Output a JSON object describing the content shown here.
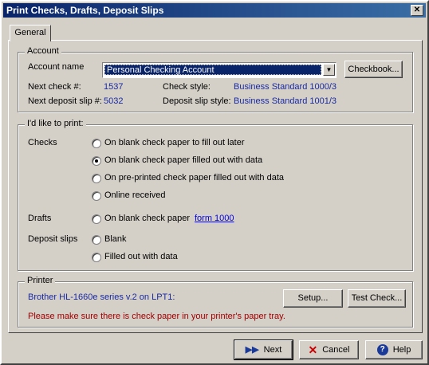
{
  "window": {
    "title": "Print Checks, Drafts, Deposit Slips",
    "close_glyph": "✕"
  },
  "tabs": [
    {
      "label": "General"
    }
  ],
  "account": {
    "group_label": "Account",
    "name_label": "Account name",
    "selected_account": "Personal Checking Account",
    "checkbook_button": "Checkbook...",
    "next_check_label": "Next check #:",
    "next_check_value": "1537",
    "check_style_label": "Check style:",
    "check_style_value": "Business Standard 1000/3",
    "next_deposit_label": "Next deposit slip #:",
    "next_deposit_value": "5032",
    "deposit_style_label": "Deposit slip style:",
    "deposit_style_value": "Business Standard 1001/3"
  },
  "print": {
    "group_label": "I'd like to print:",
    "checks_label": "Checks",
    "checks_options": [
      {
        "label": "On blank check paper to fill out later",
        "selected": false
      },
      {
        "label": "On blank check paper filled out with data",
        "selected": true
      },
      {
        "label": "On pre-printed check paper filled out with data",
        "selected": false
      },
      {
        "label": "Online received",
        "selected": false
      }
    ],
    "drafts_label": "Drafts",
    "drafts_option": {
      "label": "On blank check paper",
      "selected": false
    },
    "drafts_link": "form 1000",
    "deposit_label": "Deposit slips",
    "deposit_options": [
      {
        "label": "Blank",
        "selected": false
      },
      {
        "label": "Filled out with data",
        "selected": false
      }
    ]
  },
  "printer": {
    "group_label": "Printer",
    "name": "Brother HL-1660e series v.2 on LPT1:",
    "setup_button": "Setup...",
    "test_button": "Test Check...",
    "warning": "Please make sure there is check paper in your printer's paper tray."
  },
  "footer": {
    "next_button": "Next",
    "cancel_button": "Cancel",
    "help_button": "Help"
  },
  "colors": {
    "title_bar": "#0a246a",
    "link_blue": "#1a2aa0",
    "warning_red": "#a00000",
    "face": "#d4d0c8"
  }
}
